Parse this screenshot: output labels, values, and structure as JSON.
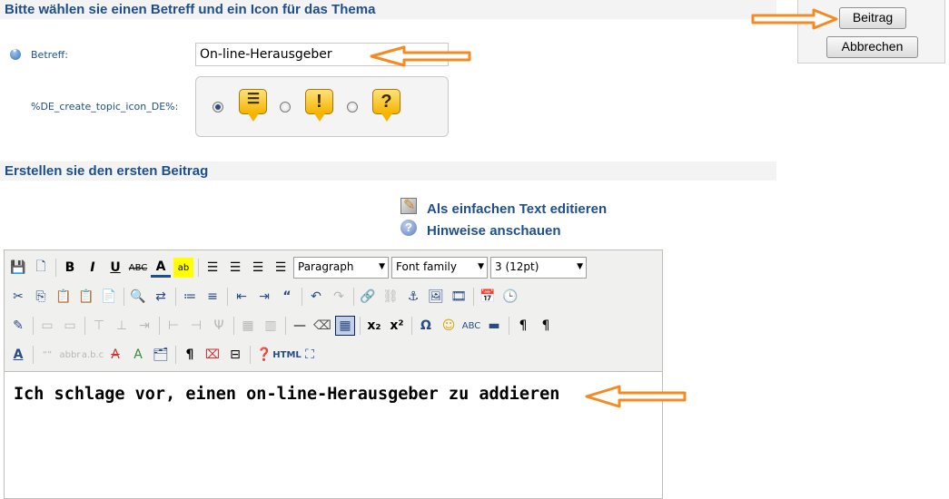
{
  "header_subject": "Bitte wählen sie einen Betreff und ein Icon für das Thema",
  "header_post": "Erstellen sie den ersten Beitrag",
  "actions": {
    "post_label": "Beitrag",
    "cancel_label": "Abbrechen"
  },
  "subject": {
    "label": "Betreff:",
    "value": "On-line-Herausgeber"
  },
  "topic_icon": {
    "label": "%DE_create_topic_icon_DE%:",
    "options": [
      "lines",
      "exclamation",
      "question"
    ],
    "selected": 0
  },
  "links": {
    "plain_text": "Als einfachen Text editieren",
    "hints": "Hinweise anschauen"
  },
  "toolbar": {
    "format": "Paragraph",
    "font_family": "Font family",
    "font_size": "3 (12pt)"
  },
  "editor": {
    "content": "Ich schlage vor, einen on-line-Herausgeber zu addieren"
  },
  "colors": {
    "accent": "#1e4f8c",
    "arrow": "#f58a22"
  }
}
